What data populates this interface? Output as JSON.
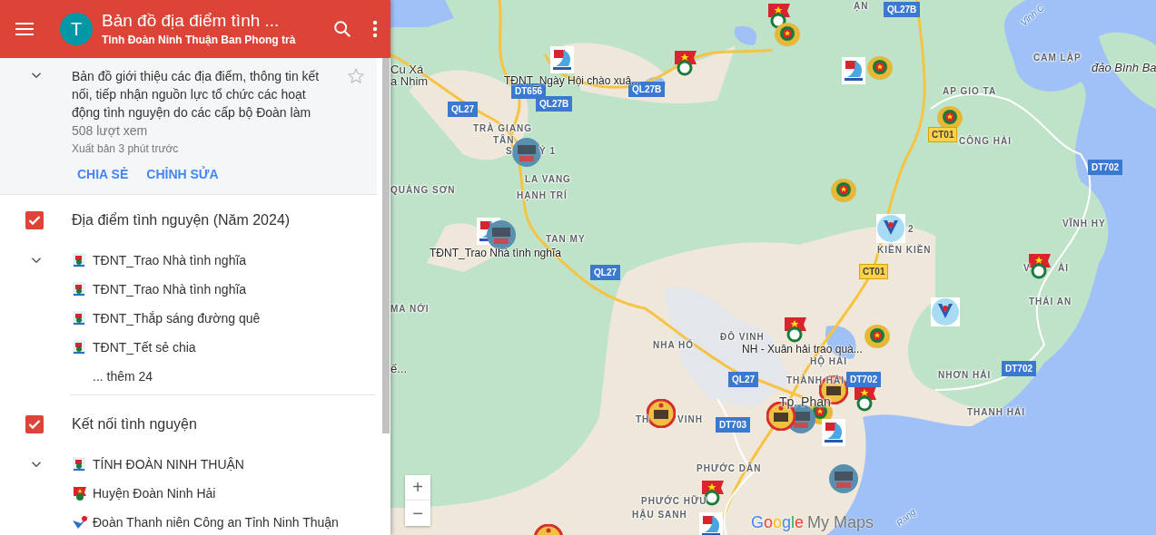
{
  "header": {
    "avatar_letter": "T",
    "title": "Bản đồ địa điểm tình ...",
    "subtitle": "Tỉnh Đoàn Ninh Thuận Ban Phong trà"
  },
  "description": {
    "text": "Bản đồ giới thiệu các địa điểm, thông tin kết nối, tiếp nhận nguồn lực tổ chức các hoạt động tình nguyện do các cấp bộ Đoàn làm",
    "views": "508 lượt xem",
    "published": "Xuất bản 3 phút trước",
    "starred": false,
    "actions": [
      "CHIA SẺ",
      "CHỈNH SỬA"
    ]
  },
  "layers": [
    {
      "name": "Địa điểm tình nguyện (Năm 2024)",
      "checked": true,
      "items": [
        {
          "label": "TĐNT_Trao Nhà tình nghĩa",
          "kind": "logo"
        },
        {
          "label": "TĐNT_Trao Nhà tình nghĩa",
          "kind": "logo"
        },
        {
          "label": "TĐNT_Thắp sáng đường quê",
          "kind": "logo"
        },
        {
          "label": "TĐNT_Tết sẻ chia",
          "kind": "logo"
        }
      ],
      "more": "... thêm 24"
    },
    {
      "name": "Kết nối tình nguyện",
      "checked": true,
      "items": [
        {
          "label": "TÍNH ĐOÀN NINH THUẬN",
          "kind": "logo"
        },
        {
          "label": "Huyện Đoàn Ninh Hải",
          "kind": "flag"
        },
        {
          "label": "Đoàn Thanh niên Công an Tỉnh Ninh Thuận",
          "kind": "badge"
        }
      ]
    }
  ],
  "map": {
    "place_labels": [
      {
        "label": "Cu Xá",
        "kind": "town"
      },
      {
        "label": "a Nhim",
        "kind": "town"
      },
      {
        "label": "TRÀ GIANG",
        "kind": "area"
      },
      {
        "label": "TÂN",
        "kind": "area"
      },
      {
        "label": "S",
        "kind": "area"
      },
      {
        "label": "Ỷ 1",
        "kind": "area"
      },
      {
        "label": "LA VANG",
        "kind": "area"
      },
      {
        "label": "HẠNH TRÍ",
        "kind": "area"
      },
      {
        "label": "QUẢNG SƠN",
        "kind": "area"
      },
      {
        "label": "TAN MY",
        "kind": "area"
      },
      {
        "label": "ẠN",
        "kind": "area"
      },
      {
        "label": "Vĩnh C",
        "kind": "water"
      },
      {
        "label": "CAM LẬP",
        "kind": "area"
      },
      {
        "label": "đảo Bình Ba",
        "kind": "island"
      },
      {
        "label": "AP GIO TA",
        "kind": "area"
      },
      {
        "label": "CÔNG HẢI",
        "kind": "area"
      },
      {
        "label": "2",
        "kind": "area"
      },
      {
        "label": "KIỀN KIỀN",
        "kind": "area"
      },
      {
        "label": "VĨNH HY",
        "kind": "area"
      },
      {
        "label": "V",
        "kind": "area"
      },
      {
        "label": "ẢI",
        "kind": "area"
      },
      {
        "label": "THÁI AN",
        "kind": "area"
      },
      {
        "label": "MA NỚI",
        "kind": "area"
      },
      {
        "label": "ế...",
        "kind": "town"
      },
      {
        "label": "NHA HỐ",
        "kind": "area"
      },
      {
        "label": "ĐÔ VINH",
        "kind": "area"
      },
      {
        "label": "HỘ HẢI",
        "kind": "area"
      },
      {
        "label": "THÀNH HẢI",
        "kind": "area"
      },
      {
        "label": "NHƠN HẢI",
        "kind": "area"
      },
      {
        "label": "THANH HẢI",
        "kind": "area"
      },
      {
        "label": "Tp. Phan",
        "kind": "city"
      },
      {
        "label": "TH",
        "kind": "area"
      },
      {
        "label": "VINH",
        "kind": "area"
      },
      {
        "label": "PHƯỚC DÂN",
        "kind": "area"
      },
      {
        "label": "PHƯỚC HỮU",
        "kind": "area"
      },
      {
        "label": "HẬU SANH",
        "kind": "area"
      },
      {
        "label": "Rang",
        "kind": "water"
      }
    ],
    "road_shields": [
      {
        "label": "DT656",
        "kind": "highway"
      },
      {
        "label": "QL27B",
        "kind": "highway"
      },
      {
        "label": "QL27B",
        "kind": "highway"
      },
      {
        "label": "QL27",
        "kind": "highway"
      },
      {
        "label": "QL27",
        "kind": "highway"
      },
      {
        "label": "QL27B",
        "kind": "highway"
      },
      {
        "label": "CT01",
        "kind": "expressway"
      },
      {
        "label": "DT702",
        "kind": "highway"
      },
      {
        "label": "CT01",
        "kind": "expressway"
      },
      {
        "label": "DT702",
        "kind": "highway"
      },
      {
        "label": "QL27",
        "kind": "highway"
      },
      {
        "label": "DT702",
        "kind": "highway"
      },
      {
        "label": "DT703",
        "kind": "highway"
      }
    ],
    "marker_labels": [
      "TĐNT_Ngày Hội chào xuâ...",
      "TĐNT_Trao Nhà tình nghĩa",
      "NH - Xuân hải trao quà..."
    ],
    "zoom_in": "+",
    "zoom_out": "−",
    "attribution": {
      "brand": "Google",
      "product": "My Maps"
    }
  }
}
